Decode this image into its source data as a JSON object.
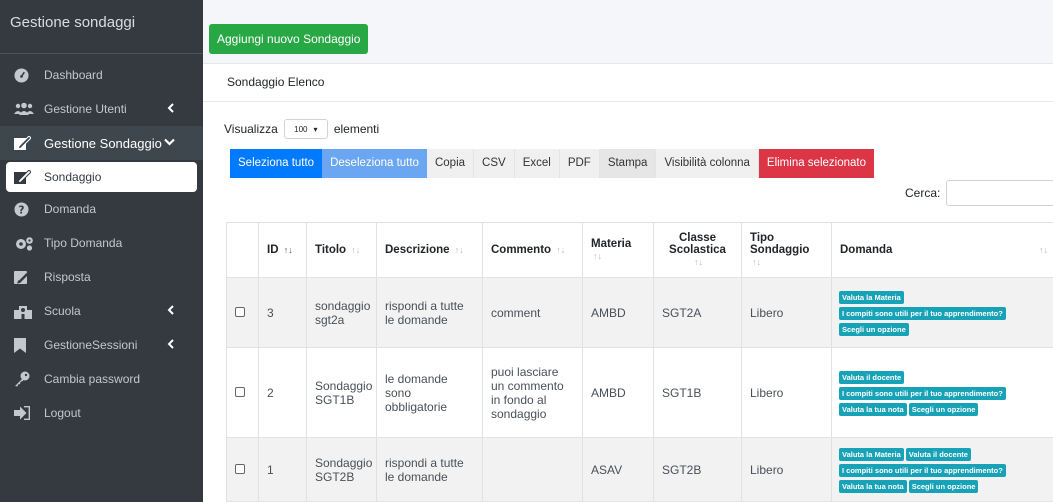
{
  "sidebar": {
    "brand": "Gestione sondaggi",
    "items": [
      {
        "label": "Dashboard"
      },
      {
        "label": "Gestione Utenti"
      },
      {
        "label": "Gestione Sondaggio"
      },
      {
        "label": "Sondaggio"
      },
      {
        "label": "Domanda"
      },
      {
        "label": "Tipo Domanda"
      },
      {
        "label": "Risposta"
      },
      {
        "label": "Scuola"
      },
      {
        "label": "GestioneSessioni"
      },
      {
        "label": "Cambia password"
      },
      {
        "label": "Logout"
      }
    ]
  },
  "toolbar": {
    "add_label": "Aggiungi nuovo Sondaggio"
  },
  "card": {
    "title": "Sondaggio Elenco"
  },
  "length": {
    "prefix": "Visualizza",
    "value": "100",
    "suffix": "elementi"
  },
  "buttons": {
    "select_all": "Seleziona tutto",
    "deselect_all": "Deseleziona tutto",
    "copy": "Copia",
    "csv": "CSV",
    "excel": "Excel",
    "pdf": "PDF",
    "print": "Stampa",
    "col_vis": "Visibilità colonna",
    "delete_selected": "Elimina selezionato"
  },
  "search": {
    "label": "Cerca:",
    "value": ""
  },
  "table": {
    "headers": {
      "id": "ID",
      "titolo": "Titolo",
      "descrizione": "Descrizione",
      "commento": "Commento",
      "materia": "Materia",
      "classe_1": "Classe",
      "classe_2": "Scolastica",
      "tipo_1": "Tipo",
      "tipo_2": "Sondaggio",
      "domanda": "Domanda"
    },
    "rows": [
      {
        "id": "3",
        "titolo": "sondaggio sgt2a",
        "descrizione": "rispondi a tutte le domande",
        "commento": "comment",
        "materia": "AMBD",
        "classe": "SGT2A",
        "tipo": "Libero",
        "tags": [
          "Valuta la Materia",
          "I compiti sono utili per il tuo apprendimento?",
          "Scegli un opzione"
        ]
      },
      {
        "id": "2",
        "titolo": "Sondaggio SGT1B",
        "descrizione": "le domande sono obbligatorie",
        "commento": "puoi lasciare un commento in fondo al sondaggio",
        "materia": "AMBD",
        "classe": "SGT1B",
        "tipo": "Libero",
        "tags": [
          "Valuta il docente",
          "I compiti sono utili per il tuo apprendimento?",
          "Valuta la tua nota",
          "Scegli un opzione"
        ]
      },
      {
        "id": "1",
        "titolo": "Sondaggio SGT2B",
        "descrizione": "rispondi a tutte le domande",
        "commento": "",
        "materia": "ASAV",
        "classe": "SGT2B",
        "tipo": "Libero",
        "tags": [
          "Valuta la Materia",
          "Valuta il docente",
          "I compiti sono utili per il tuo apprendimento?",
          "Valuta la tua nota",
          "Scegli un opzione"
        ]
      }
    ]
  },
  "icons": {
    "dashboard": "tachometer-icon",
    "users": "users-icon",
    "survey": "edit-icon",
    "question": "question-circle-icon",
    "types": "cogs-icon",
    "answer": "pen-square-icon",
    "school": "school-icon",
    "sessions": "bookmark-icon",
    "password": "key-icon",
    "logout": "sign-out-icon"
  }
}
